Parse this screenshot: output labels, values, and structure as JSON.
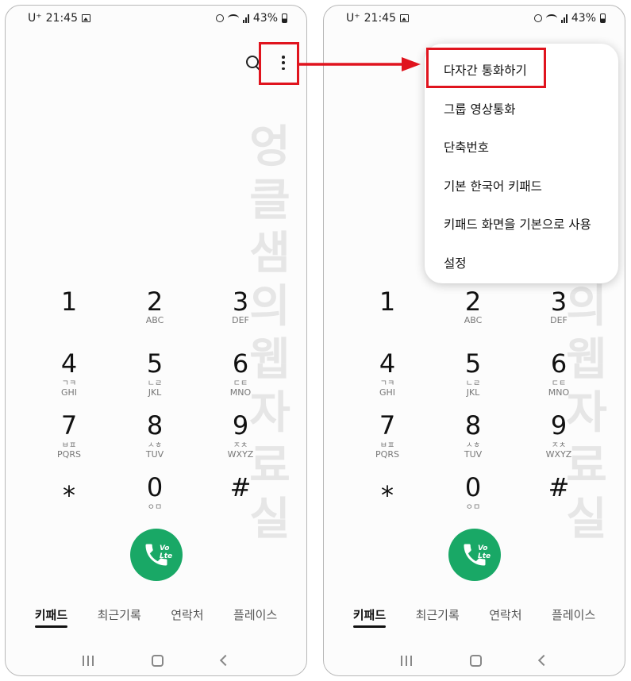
{
  "status_bar": {
    "carrier": "U⁺",
    "time": "21:45",
    "battery": "43%"
  },
  "watermark": "엉클샘의웹자료실",
  "keypad": [
    {
      "digit": "1",
      "sub": "",
      "sub2": ""
    },
    {
      "digit": "2",
      "sub": "",
      "sub2": "ABC"
    },
    {
      "digit": "3",
      "sub": "",
      "sub2": "DEF"
    },
    {
      "digit": "4",
      "sub": "ㄱㅋ",
      "sub2": "GHI"
    },
    {
      "digit": "5",
      "sub": "ㄴㄹ",
      "sub2": "JKL"
    },
    {
      "digit": "6",
      "sub": "ㄷㅌ",
      "sub2": "MNO"
    },
    {
      "digit": "7",
      "sub": "ㅂㅍ",
      "sub2": "PQRS"
    },
    {
      "digit": "8",
      "sub": "ㅅㅎ",
      "sub2": "TUV"
    },
    {
      "digit": "9",
      "sub": "ㅈㅊ",
      "sub2": "WXYZ"
    },
    {
      "digit": "⁎",
      "sub": "",
      "sub2": ""
    },
    {
      "digit": "0",
      "sub": "ㅇㅁ",
      "sub2": ""
    },
    {
      "digit": "#",
      "sub": "",
      "sub2": ""
    }
  ],
  "call_button": {
    "label": "Vo Lte"
  },
  "tabs": [
    {
      "label": "키패드",
      "active": true
    },
    {
      "label": "최근기록",
      "active": false
    },
    {
      "label": "연락처",
      "active": false
    },
    {
      "label": "플레이스",
      "active": false
    }
  ],
  "menu": {
    "items": [
      "다자간 통화하기",
      "그룹 영상통화",
      "단축번호",
      "기본 한국어 키패드",
      "키패드 화면을 기본으로 사용",
      "설정"
    ]
  },
  "colors": {
    "call_green": "#19a866",
    "highlight_red": "#e0141e"
  }
}
